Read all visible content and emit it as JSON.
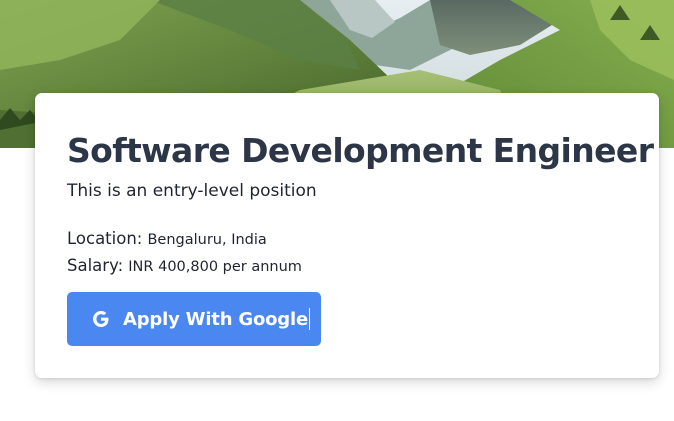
{
  "job": {
    "title": "Software Development Engineer",
    "subtitle": "This is an entry-level position",
    "location_label": "Location:",
    "location_value": "Bengaluru, India",
    "salary_label": "Salary:",
    "salary_value": "INR 400,800 per annum"
  },
  "apply_button": {
    "label": "Apply With Google",
    "icon": "google-g-icon"
  },
  "colors": {
    "button": "#4a87f0",
    "title": "#2d3646",
    "sky": "#dfe8ec",
    "hill": "#6f9a44"
  }
}
